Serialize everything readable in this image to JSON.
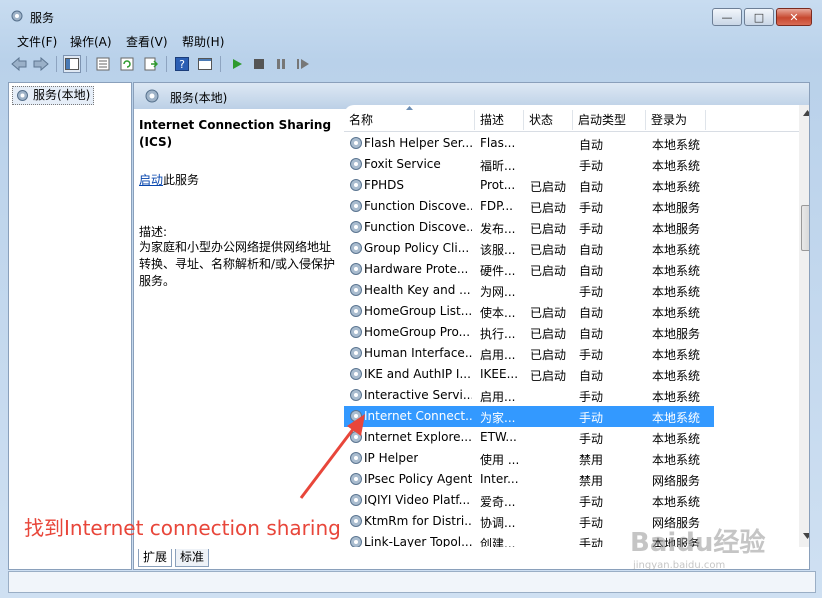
{
  "window": {
    "title": "服务",
    "minimize": "—",
    "maximize": "□",
    "close": "✕"
  },
  "menu": [
    "文件(F)",
    "操作(A)",
    "查看(V)",
    "帮助(H)"
  ],
  "tree": {
    "root": "服务(本地)"
  },
  "main": {
    "header": "服务(本地)",
    "service_name": "Internet Connection Sharing (ICS)",
    "start_link": "启动",
    "start_suffix": "此服务",
    "desc_label": "描述:",
    "desc_text": "为家庭和小型办公网络提供网络地址转换、寻址、名称解析和/或入侵保护服务。"
  },
  "columns": [
    "名称",
    "描述",
    "状态",
    "启动类型",
    "登录为"
  ],
  "rows": [
    {
      "name": "Flash Helper Ser...",
      "desc": "Flas...",
      "status": "",
      "startup": "自动",
      "logon": "本地系统"
    },
    {
      "name": "Foxit Service",
      "desc": "福昕...",
      "status": "",
      "startup": "手动",
      "logon": "本地系统"
    },
    {
      "name": "FPHDS",
      "desc": "Prot...",
      "status": "已启动",
      "startup": "自动",
      "logon": "本地系统"
    },
    {
      "name": "Function Discove...",
      "desc": "FDP...",
      "status": "已启动",
      "startup": "手动",
      "logon": "本地服务"
    },
    {
      "name": "Function Discove...",
      "desc": "发布...",
      "status": "已启动",
      "startup": "手动",
      "logon": "本地服务"
    },
    {
      "name": "Group Policy Cli...",
      "desc": "该服...",
      "status": "已启动",
      "startup": "自动",
      "logon": "本地系统"
    },
    {
      "name": "Hardware Prote...",
      "desc": "硬件...",
      "status": "已启动",
      "startup": "自动",
      "logon": "本地系统"
    },
    {
      "name": "Health Key and ...",
      "desc": "为网...",
      "status": "",
      "startup": "手动",
      "logon": "本地系统"
    },
    {
      "name": "HomeGroup List...",
      "desc": "使本...",
      "status": "已启动",
      "startup": "自动",
      "logon": "本地系统"
    },
    {
      "name": "HomeGroup Pro...",
      "desc": "执行...",
      "status": "已启动",
      "startup": "自动",
      "logon": "本地服务"
    },
    {
      "name": "Human Interface...",
      "desc": "启用...",
      "status": "已启动",
      "startup": "手动",
      "logon": "本地系统"
    },
    {
      "name": "IKE and AuthIP I...",
      "desc": "IKEE...",
      "status": "已启动",
      "startup": "自动",
      "logon": "本地系统"
    },
    {
      "name": "Interactive Servi...",
      "desc": "启用...",
      "status": "",
      "startup": "手动",
      "logon": "本地系统"
    },
    {
      "name": "Internet Connect...",
      "desc": "为家...",
      "status": "",
      "startup": "手动",
      "logon": "本地系统",
      "selected": true
    },
    {
      "name": "Internet Explore...",
      "desc": "ETW...",
      "status": "",
      "startup": "手动",
      "logon": "本地系统"
    },
    {
      "name": "IP Helper",
      "desc": "使用 ...",
      "status": "",
      "startup": "禁用",
      "logon": "本地系统"
    },
    {
      "name": "IPsec Policy Agent",
      "desc": "Inter...",
      "status": "",
      "startup": "禁用",
      "logon": "网络服务"
    },
    {
      "name": "IQIYI Video Platf...",
      "desc": "爱奇...",
      "status": "",
      "startup": "手动",
      "logon": "本地系统"
    },
    {
      "name": "KtmRm for Distri...",
      "desc": "协调...",
      "status": "",
      "startup": "手动",
      "logon": "网络服务"
    },
    {
      "name": "Link-Layer Topol...",
      "desc": "创建...",
      "status": "",
      "startup": "手动",
      "logon": "本地服务"
    }
  ],
  "tabs": [
    "扩展",
    "标准"
  ],
  "annotation": "找到Internet connection sharing",
  "watermark": "Baidu经验",
  "watermark_url": "jingyan.baidu.com",
  "colors": {
    "selection": "#3399ff",
    "annotation": "#e8463a",
    "link": "#0645ad"
  }
}
